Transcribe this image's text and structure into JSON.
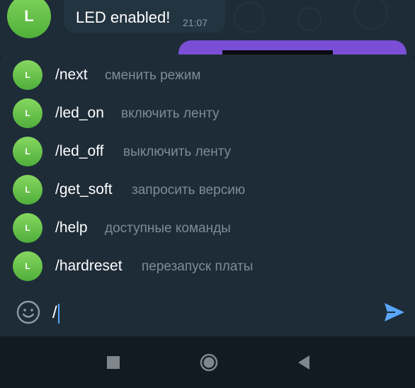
{
  "chat": {
    "incoming_message": {
      "avatar_letter": "L",
      "text": "LED enabled!",
      "time": "21:07"
    }
  },
  "suggestions": [
    {
      "avatar_letter": "L",
      "command": "/next",
      "description": "сменить режим"
    },
    {
      "avatar_letter": "L",
      "command": "/led_on",
      "description": "включить ленту"
    },
    {
      "avatar_letter": "L",
      "command": "/led_off",
      "description": "выключить ленту"
    },
    {
      "avatar_letter": "L",
      "command": "/get_soft",
      "description": "запросить версию"
    },
    {
      "avatar_letter": "L",
      "command": "/help",
      "description": "доступные команды"
    },
    {
      "avatar_letter": "L",
      "command": "/hardreset",
      "description": "перезапуск платы"
    }
  ],
  "input": {
    "value": "/",
    "emoji_icon": "emoji-icon",
    "send_icon": "send-icon"
  },
  "navigation": {
    "recents_icon": "square-icon",
    "home_icon": "circle-icon",
    "back_icon": "triangle-back-icon"
  },
  "colors": {
    "accent": "#59a6ff",
    "avatar_green": "#4fb03a",
    "outgoing_bubble": "#7a4fd6"
  }
}
